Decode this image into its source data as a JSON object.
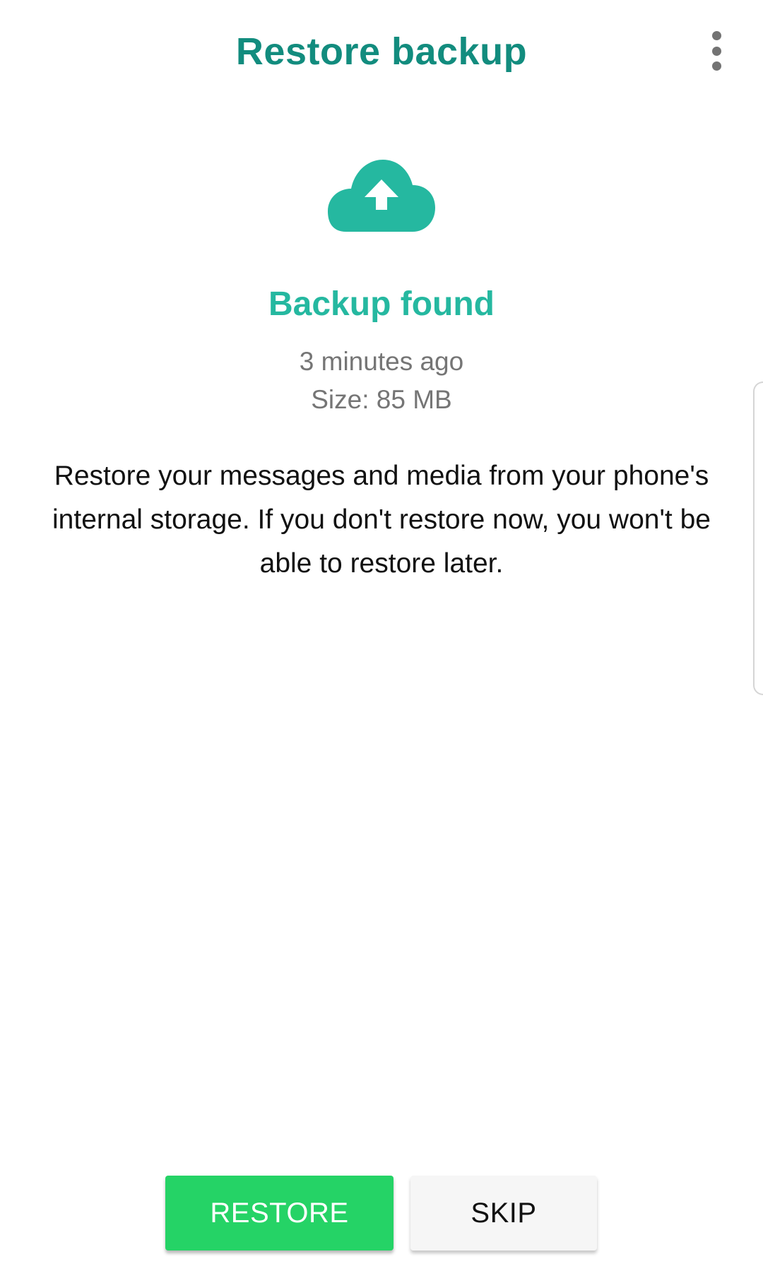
{
  "header": {
    "title": "Restore backup",
    "menu_icon": "more-vertical-icon"
  },
  "backup": {
    "icon": "cloud-upload-icon",
    "status": "Backup found",
    "time": "3 minutes ago",
    "size": "Size: 85 MB",
    "description": "Restore your messages and media from your phone's internal storage. If you don't restore now, you won't be able to restore later."
  },
  "actions": {
    "restore_label": "RESTORE",
    "skip_label": "SKIP"
  },
  "colors": {
    "title": "#128c7e",
    "accent": "#25b8a0",
    "restore_button": "#25d366",
    "skip_button": "#f6f6f6"
  }
}
